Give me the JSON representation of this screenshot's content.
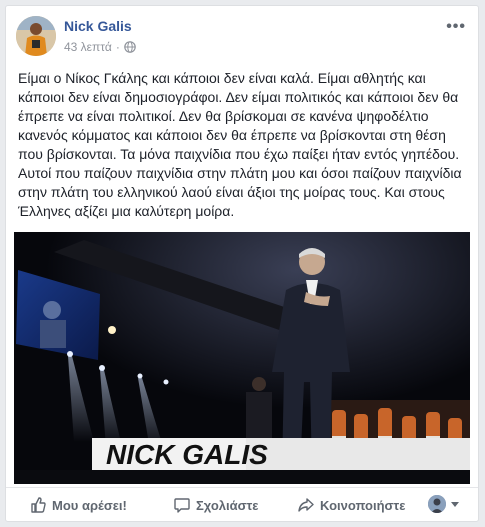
{
  "post": {
    "author": "Nick Galis",
    "time": "43 λεπτά",
    "separator": "·",
    "text": "Είμαι ο Νίκος Γκάλης και κάποιοι δεν είναι καλά. Είμαι αθλητής και κάποιοι δεν είναι δημοσιογράφοι. Δεν είμαι πολιτικός και κάποιοι δεν θα έπρεπε να είναι πολιτικοί. Δεν θα βρίσκομαι σε κανένα ψηφοδέλτιο κανενός κόμματος και κάποιοι δεν θα έπρεπε να βρίσκονται στη θέση που βρίσκονται. Τα μόνα παιχνίδια που έχω παίξει ήταν εντός γηπέδου. Αυτοί που παίζουν παιχνίδια στην πλάτη μου και όσοι παίζουν παιχνίδια στην πλάτη του ελληνικού λαού είναι άξιοι της μοίρας τους. Και στους Έλληνες αξίζει μια καλύτερη μοίρα.",
    "photo_banner": "NICK GALIS",
    "more_glyph": "•••"
  },
  "actions": {
    "like": "Μου αρέσει!",
    "comment": "Σχολιάστε",
    "share": "Κοινοποιήστε"
  },
  "icons": [
    "avatar",
    "globe-icon",
    "more-options-icon",
    "like-icon",
    "comment-icon",
    "share-icon",
    "audience-avatar-icon",
    "caret-down-icon"
  ],
  "colors": {
    "author": "#365899",
    "meta": "#90949c",
    "text": "#1d2129",
    "actions": "#606770"
  }
}
